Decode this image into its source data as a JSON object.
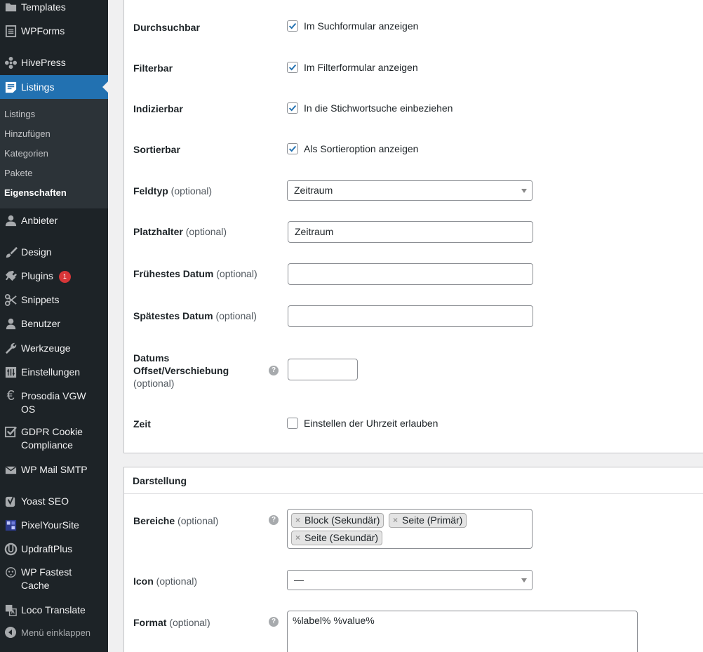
{
  "sidebar": {
    "templates": "Templates",
    "wpforms": "WPForms",
    "hivepress": "HivePress",
    "listings": "Listings",
    "submenu": [
      "Listings",
      "Hinzufügen",
      "Kategorien",
      "Pakete",
      "Eigenschaften"
    ],
    "anbieter": "Anbieter",
    "design": "Design",
    "plugins": "Plugins",
    "plugins_badge": "1",
    "snippets": "Snippets",
    "benutzer": "Benutzer",
    "werkzeuge": "Werkzeuge",
    "einstellungen": "Einstellungen",
    "prosodia_1": "Prosodia VGW",
    "prosodia_2": "OS",
    "gdpr_1": "GDPR Cookie",
    "gdpr_2": "Compliance",
    "wpmail": "WP Mail SMTP",
    "yoast": "Yoast SEO",
    "pixel": "PixelYourSite",
    "updraft": "UpdraftPlus",
    "fastest_1": "WP Fastest",
    "fastest_2": "Cache",
    "loco": "Loco Translate",
    "collapse": "Menü einklappen"
  },
  "optional": "(optional)",
  "help_glyph": "?",
  "search_panel": {
    "durchsuchbar": {
      "label": "Durchsuchbar",
      "checkbox": "Im Suchformular anzeigen",
      "checked": true
    },
    "filterbar": {
      "label": "Filterbar",
      "checkbox": "Im Filterformular anzeigen",
      "checked": true
    },
    "indizierbar": {
      "label": "Indizierbar",
      "checkbox": "In die Stichwortsuche einbeziehen",
      "checked": true
    },
    "sortierbar": {
      "label": "Sortierbar",
      "checkbox": "Als Sortieroption anzeigen",
      "checked": true
    },
    "feldtyp": {
      "label": "Feldtyp",
      "value": "Zeitraum"
    },
    "platzhalter": {
      "label": "Platzhalter",
      "value": "Zeitraum"
    },
    "fruehestes": {
      "label": "Frühestes Datum",
      "value": ""
    },
    "spaetestes": {
      "label": "Spätestes Datum",
      "value": ""
    },
    "offset": {
      "label_1": "Datums",
      "label_2": "Offset/Verschiebung",
      "value": ""
    },
    "zeit": {
      "label": "Zeit",
      "checkbox": "Einstellen der Uhrzeit erlauben",
      "checked": false
    }
  },
  "display_panel": {
    "title": "Darstellung",
    "bereiche": {
      "label": "Bereiche",
      "tags": [
        "Block (Sekundär)",
        "Seite (Primär)",
        "Seite (Sekundär)"
      ],
      "remove_glyph": "×"
    },
    "icon": {
      "label": "Icon",
      "value": "—"
    },
    "format": {
      "label": "Format",
      "value": "%label% %value%"
    }
  },
  "colors": {
    "sidebar_bg": "#1d2327",
    "active": "#2271b1",
    "checkbox": "#2271b1",
    "badge": "#d63638"
  }
}
